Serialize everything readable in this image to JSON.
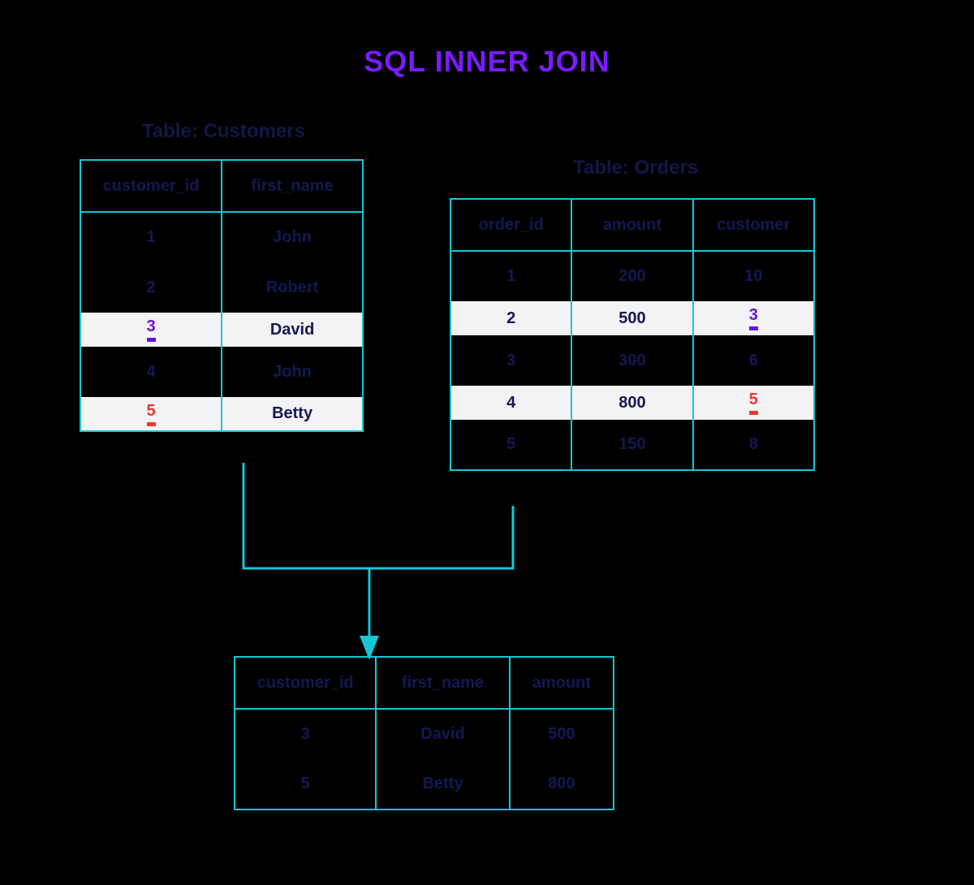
{
  "title": "SQL INNER JOIN",
  "customers": {
    "caption": "Table: Customers",
    "headers": [
      "customer_id",
      "first_name"
    ],
    "rows": [
      {
        "id": "1",
        "name": "John"
      },
      {
        "id": "2",
        "name": "Robert"
      },
      {
        "id": "3",
        "name": "David"
      },
      {
        "id": "4",
        "name": "John"
      },
      {
        "id": "5",
        "name": "Betty"
      }
    ]
  },
  "orders": {
    "caption": "Table: Orders",
    "headers": [
      "order_id",
      "amount",
      "customer"
    ],
    "rows": [
      {
        "id": "1",
        "amount": "200",
        "customer": "10"
      },
      {
        "id": "2",
        "amount": "500",
        "customer": "3"
      },
      {
        "id": "3",
        "amount": "300",
        "customer": "6"
      },
      {
        "id": "4",
        "amount": "800",
        "customer": "5"
      },
      {
        "id": "5",
        "amount": "150",
        "customer": "8"
      }
    ]
  },
  "result": {
    "headers": [
      "customer_id",
      "first_name",
      "amount"
    ],
    "rows": [
      {
        "id": "3",
        "name": "David",
        "amount": "500"
      },
      {
        "id": "5",
        "name": "Betty",
        "amount": "800"
      }
    ]
  }
}
